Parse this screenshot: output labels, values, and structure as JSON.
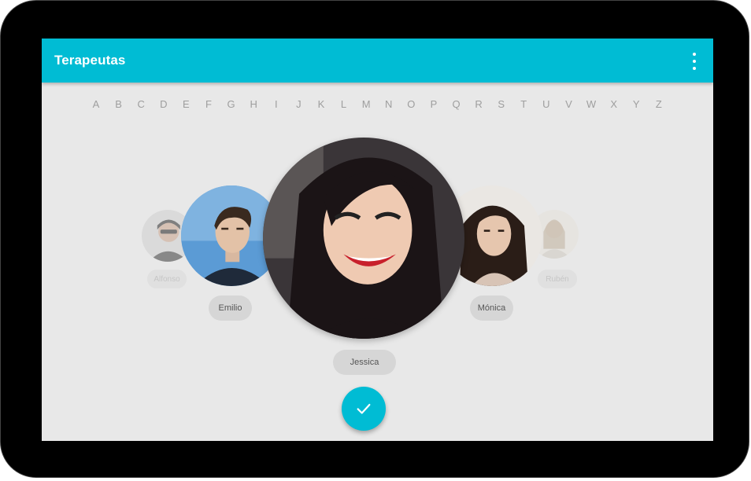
{
  "app": {
    "title": "Terapeutas",
    "menu_icon": "more-vert-icon"
  },
  "alphabet": [
    "A",
    "B",
    "C",
    "D",
    "E",
    "F",
    "G",
    "H",
    "I",
    "J",
    "K",
    "L",
    "M",
    "N",
    "O",
    "P",
    "Q",
    "R",
    "S",
    "T",
    "U",
    "V",
    "W",
    "X",
    "Y",
    "Z"
  ],
  "therapists": {
    "far_left": {
      "name": "Alfonso"
    },
    "left": {
      "name": "Emilio"
    },
    "selected": {
      "name": "Jessica"
    },
    "right": {
      "name": "Mónica"
    },
    "far_right": {
      "name": "Rubén"
    }
  },
  "fab": {
    "icon": "check-icon"
  },
  "colors": {
    "accent": "#00bcd4",
    "background": "#e8e8e8",
    "chip": "#d6d6d6"
  }
}
